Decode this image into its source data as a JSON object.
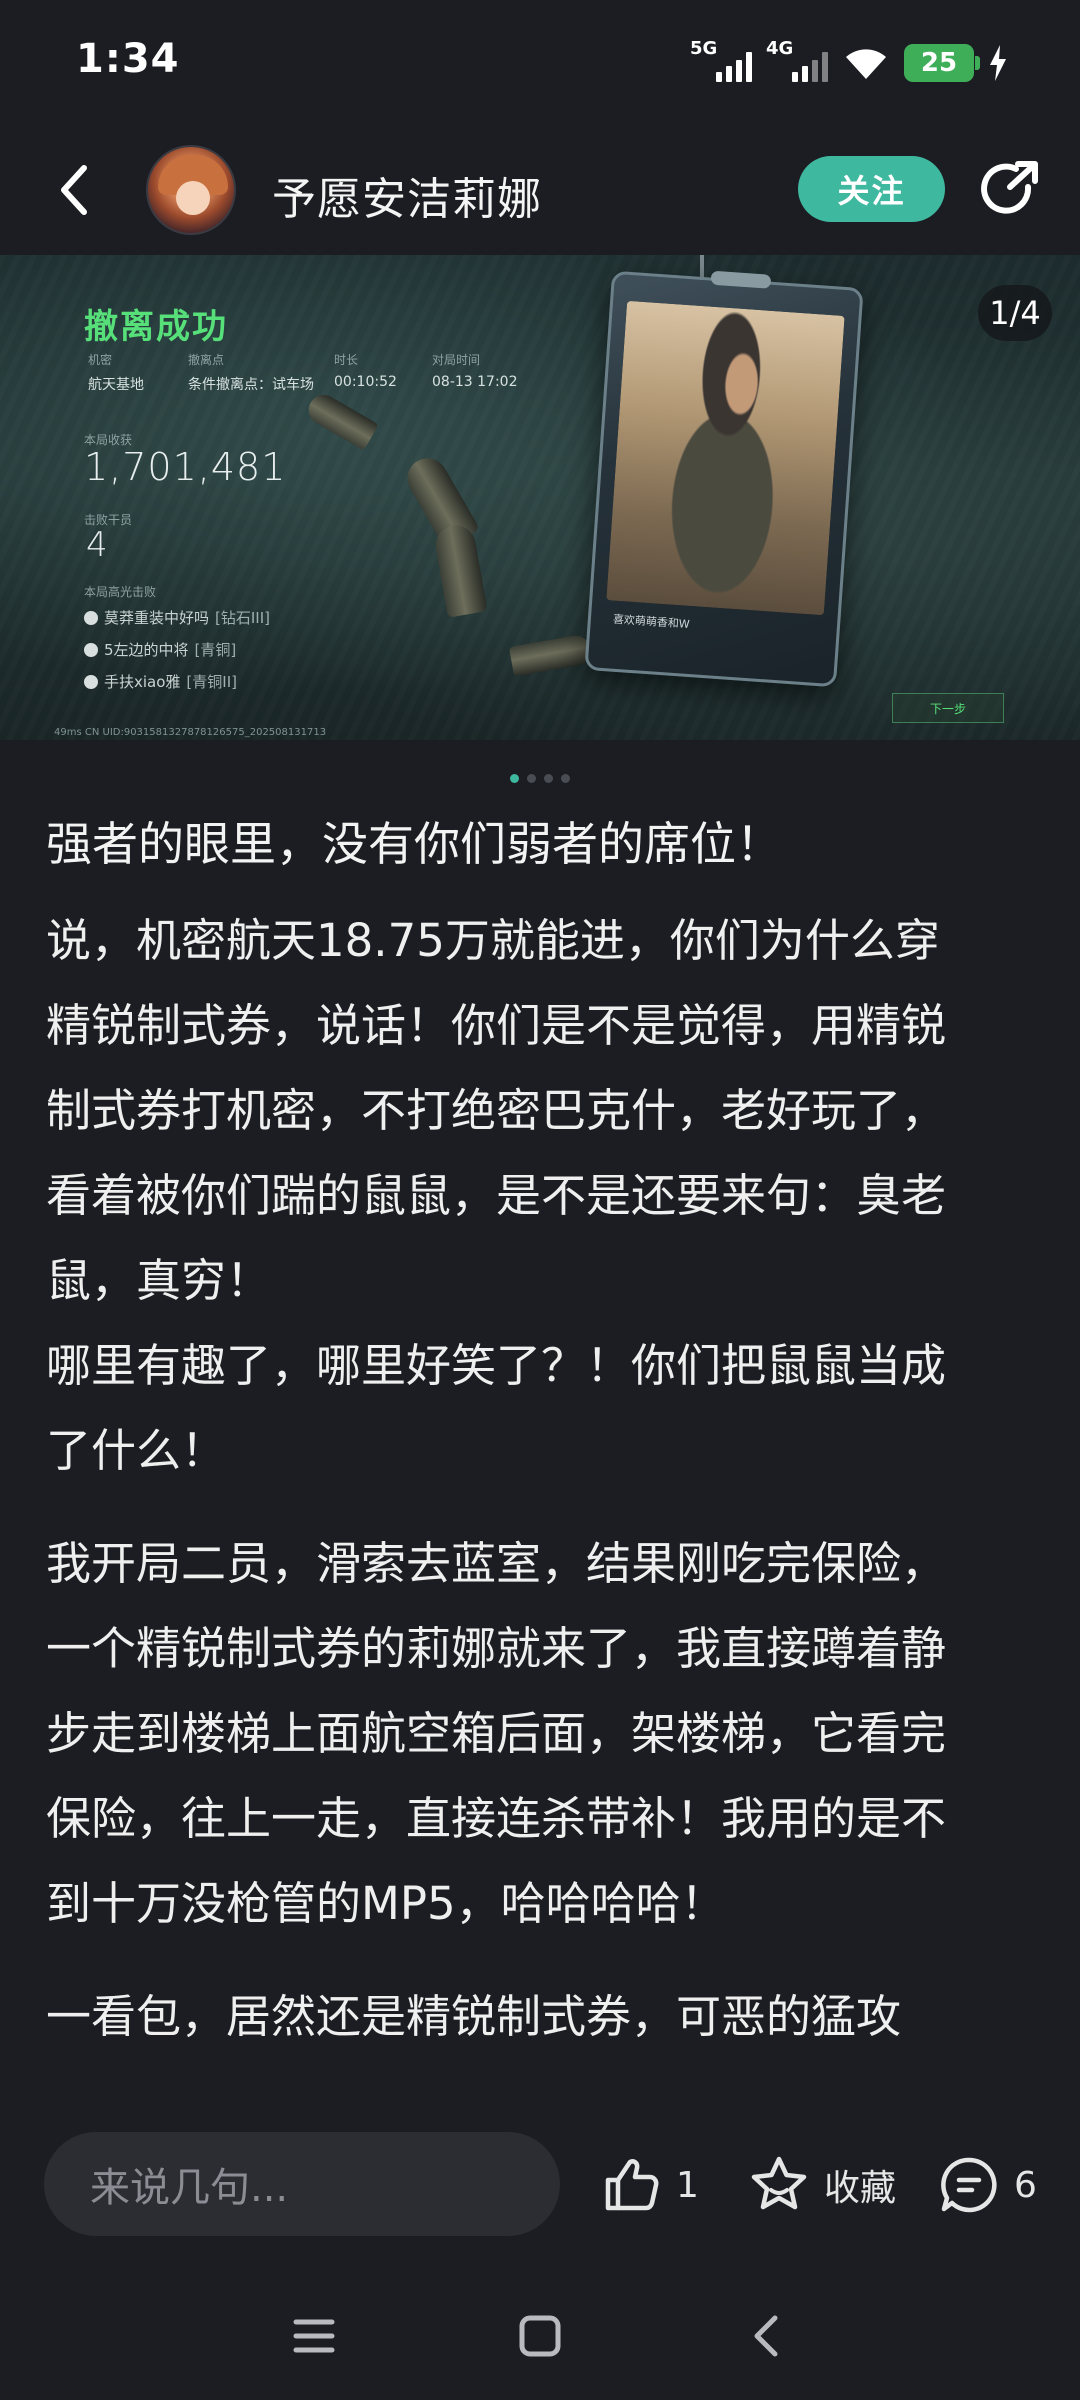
{
  "status_bar": {
    "time": "1:34",
    "net1": "5G",
    "net2": "4G",
    "battery": "25"
  },
  "header": {
    "username": "予愿安洁莉娜",
    "follow_label": "关注"
  },
  "banner": {
    "counter": "1/4",
    "extract_title": "撤离成功",
    "meta_labels": [
      "机密",
      "撤离点",
      "时长",
      "对局时间"
    ],
    "meta_values": [
      "航天基地",
      "条件撤离点：试车场",
      "00:10:52",
      "08-13 17:02"
    ],
    "income_label": "本局收获",
    "income_value": "1,701,481",
    "kills_label": "击败干员",
    "kills_value": "4",
    "highlight_label": "本局高光击败",
    "kill_list": [
      {
        "name": "莫莽重装中好吗",
        "rank": "[钻石III]"
      },
      {
        "name": "5左边的中将",
        "rank": "[青铜]"
      },
      {
        "name": "手扶xiao雅",
        "rank": "[青铜II]"
      }
    ],
    "card_name": "喜欢萌萌香和W",
    "uid_text": "49ms   CN UID:9031581327878126575_202508131713",
    "next_label": "下一步",
    "total_pages": 4,
    "active_page": 1
  },
  "post": {
    "title": "强者的眼里，没有你们弱者的席位！",
    "paragraphs": [
      [
        "说，机密航天18.75万就能进，你们为什么穿",
        "精锐制式券，说话！你们是不是觉得，用精锐",
        "制式券打机密，不打绝密巴克什，老好玩了，",
        "看着被你们踹的鼠鼠，是不是还要来句：臭老",
        "鼠，真穷！"
      ],
      [
        "哪里有趣了，哪里好笑了？！你们把鼠鼠当成",
        "了什么！"
      ],
      [
        "我开局二员，滑索去蓝室，结果刚吃完保险，",
        "一个精锐制式券的莉娜就来了，我直接蹲着静",
        "步走到楼梯上面航空箱后面，架楼梯，它看完",
        "保险，往上一走，直接连杀带补！我用的是不",
        "到十万没枪管的MP5，哈哈哈哈！"
      ],
      [
        "一看包，居然还是精锐制式券，可恶的猛攻"
      ]
    ]
  },
  "bottom_bar": {
    "comment_placeholder": "来说几句...",
    "like_count": "1",
    "favorite_label": "收藏",
    "comment_count": "6"
  },
  "colors": {
    "accent": "#3fb8a0",
    "background": "#1c1d22",
    "success_green": "#57e07a"
  }
}
